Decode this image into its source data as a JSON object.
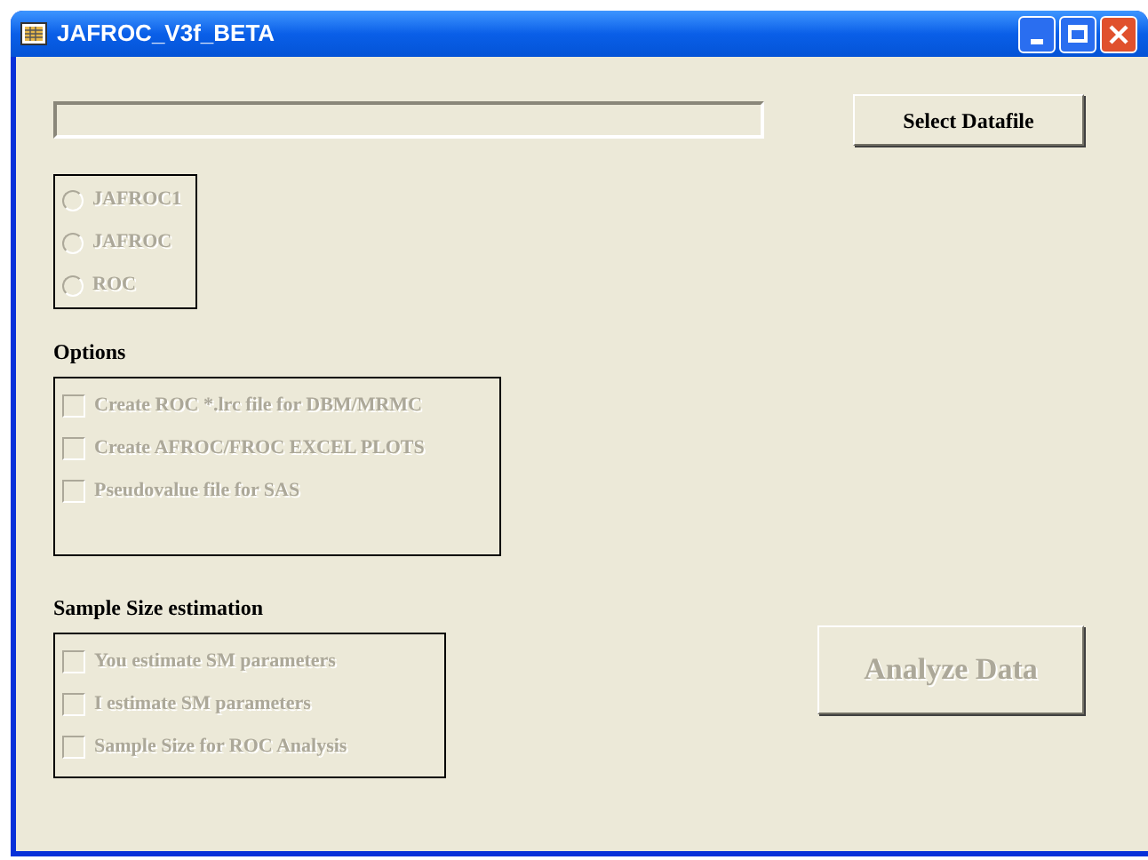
{
  "window": {
    "title": "JAFROC_V3f_BETA"
  },
  "select_button": {
    "label": "Select Datafile",
    "disabled": false
  },
  "analysis_type": [
    {
      "label": "JAFROC1",
      "selected": false,
      "disabled": true
    },
    {
      "label": "JAFROC",
      "selected": false,
      "disabled": true
    },
    {
      "label": "ROC",
      "selected": false,
      "disabled": true
    }
  ],
  "options": {
    "heading": "Options",
    "items": [
      {
        "label": "Create ROC *.lrc file for DBM/MRMC",
        "checked": false,
        "disabled": true
      },
      {
        "label": "Create AFROC/FROC EXCEL PLOTS",
        "checked": false,
        "disabled": true
      },
      {
        "label": "Pseudovalue file for SAS",
        "checked": false,
        "disabled": true
      }
    ]
  },
  "sample_size": {
    "heading": "Sample Size estimation",
    "items": [
      {
        "label": "You estimate SM parameters",
        "checked": false,
        "disabled": true
      },
      {
        "label": "I estimate SM parameters",
        "checked": false,
        "disabled": true
      },
      {
        "label": "Sample Size for ROC Analysis",
        "checked": false,
        "disabled": true
      }
    ]
  },
  "analyze_button": {
    "label": "Analyze Data",
    "disabled": true
  }
}
